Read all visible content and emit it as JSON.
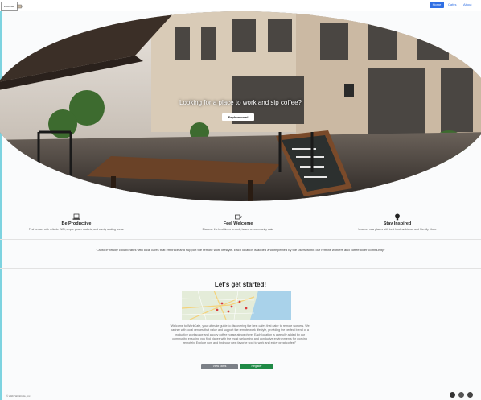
{
  "nav": {
    "logo_text": "WorkCafe",
    "primary_button": "Home",
    "link_1": "Cafes",
    "link_2": "About"
  },
  "hero": {
    "title": "Looking for a place to work and sip coffee?",
    "button": "Explore now!"
  },
  "features": [
    {
      "icon": "laptop-icon",
      "title": "Be Productive",
      "desc": "Find venues with reliable WiFi, ample power sockets, and comfy seating areas."
    },
    {
      "icon": "coffee-cup-icon",
      "title": "Feel Welcome",
      "desc": "Discover the best times to work, based on community data."
    },
    {
      "icon": "lightbulb-icon",
      "title": "Stay Inspired",
      "desc": "Uncover new places with best food, ambiance and friendly vibes."
    }
  ],
  "quote": "\"LaptopFriendly collaborates with local cafes that embrace and support the remote work lifestyle. Each location is added and inspected by the users within our remote workers and coffee lover community.\"",
  "get_started": {
    "title": "Let's get started!",
    "text": "\"Welcome to WorkCafe, your ultimate guide to discovering the best cafes that cater to remote workers. We partner with local venues that value and support the remote work lifestyle, providing the perfect blend of a productive workspace and a cozy coffee house atmosphere. Each location is carefully added by our community, ensuring you find places with the most welcoming and conducive environments for working remotely. Explore now and find your next favorite spot to work and enjoy great coffee!\"",
    "button_secondary": "View cafes",
    "button_primary": "Register"
  },
  "footer": {
    "copyright": "© 2024 WorkCafe, Inc"
  },
  "colors": {
    "primary": "#2f6fe4",
    "success": "#1f8a46",
    "secondary": "#7b8087"
  }
}
